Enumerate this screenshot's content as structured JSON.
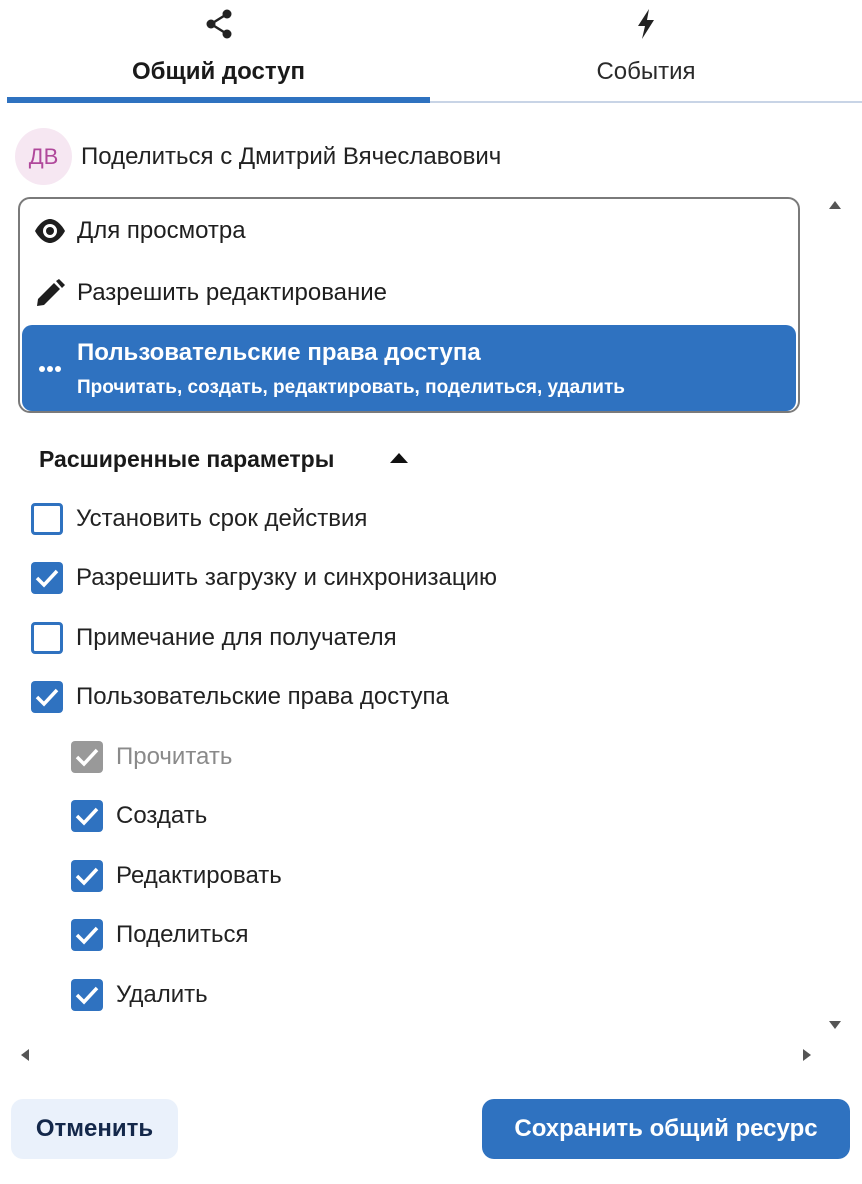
{
  "tabs": [
    {
      "label": "Общий доступ",
      "icon": "share-icon",
      "active": true
    },
    {
      "label": "События",
      "icon": "lightning-icon",
      "active": false
    }
  ],
  "share": {
    "avatar_initials": "ДВ",
    "title": "Поделиться с Дмитрий Вячеславович"
  },
  "roles": [
    {
      "label": "Для просмотра",
      "icon": "eye-icon",
      "selected": false
    },
    {
      "label": "Разрешить редактирование",
      "icon": "pencil-icon",
      "selected": false
    },
    {
      "label": "Пользовательские права доступа",
      "description": "Прочитать, создать, редактировать, поделиться, удалить",
      "icon": "ellipsis-icon",
      "selected": true
    }
  ],
  "advanced": {
    "label": "Расширенные параметры",
    "options": [
      {
        "label": "Установить срок действия",
        "checked": false
      },
      {
        "label": "Разрешить загрузку и синхронизацию",
        "checked": true
      },
      {
        "label": "Примечание для получателя",
        "checked": false
      },
      {
        "label": "Пользовательские права доступа",
        "checked": true
      }
    ],
    "permissions": [
      {
        "label": "Прочитать",
        "checked": true,
        "disabled": true
      },
      {
        "label": "Создать",
        "checked": true,
        "disabled": false
      },
      {
        "label": "Редактировать",
        "checked": true,
        "disabled": false
      },
      {
        "label": "Поделиться",
        "checked": true,
        "disabled": false
      },
      {
        "label": "Удалить",
        "checked": true,
        "disabled": false
      }
    ]
  },
  "footer": {
    "cancel_label": "Отменить",
    "save_label": "Сохранить общий ресурс"
  },
  "colors": {
    "accent": "#2f72c0",
    "avatar_bg": "#f6e7f2",
    "avatar_text": "#b0489b",
    "cancel_bg": "#eaf1fb",
    "disabled_checkbox": "#999999"
  }
}
